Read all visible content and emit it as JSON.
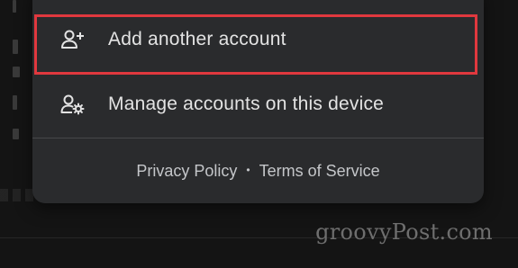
{
  "menu": {
    "add_account_label": "Add another account",
    "manage_accounts_label": "Manage accounts on this device"
  },
  "footer": {
    "privacy_label": "Privacy Policy",
    "separator": "•",
    "terms_label": "Terms of Service"
  },
  "icons": {
    "add_account": "person-add-icon",
    "manage_accounts": "manage-accounts-icon"
  },
  "colors": {
    "sheet_background": "#2a2b2d",
    "highlight": "#e0383e",
    "text": "#e3e3e3"
  },
  "watermark": "groovyPost.com"
}
